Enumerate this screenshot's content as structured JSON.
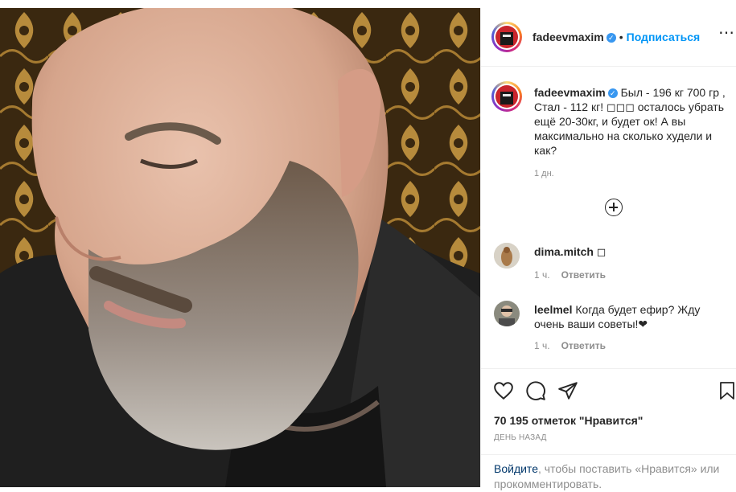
{
  "post": {
    "author": "fadeevmaxim",
    "follow_label": "Подписаться",
    "separator": "•",
    "caption": "Был - 196 кг 700 гр , Стал - 112 кг! ◻◻◻ осталось убрать ещё 20-30кг, и будет ок! А вы максимально на сколько худели и как?",
    "caption_time": "1 дн.",
    "likes": "70 195 отметок \"Нравится\"",
    "date": "ДЕНЬ НАЗАД"
  },
  "comments": [
    {
      "user": "dima.mitch",
      "text": "◻",
      "time": "1 ч.",
      "reply": "Ответить"
    },
    {
      "user": "leelmel",
      "text": "Когда будет ефир? Жду очень ваши советы!❤",
      "time": "1 ч.",
      "reply": "Ответить"
    }
  ],
  "login": {
    "link": "Войдите",
    "rest": ", чтобы поставить «Нравится» или прокомментировать."
  },
  "icons": {
    "like": "heart-icon",
    "comment": "comment-icon",
    "share": "share-icon",
    "save": "bookmark-icon",
    "add": "plus-circle-icon",
    "verified": "verified-icon",
    "more": "more-icon"
  },
  "colors": {
    "link": "#0095f6",
    "verified": "#3897f0",
    "muted": "#8e8e8e"
  }
}
